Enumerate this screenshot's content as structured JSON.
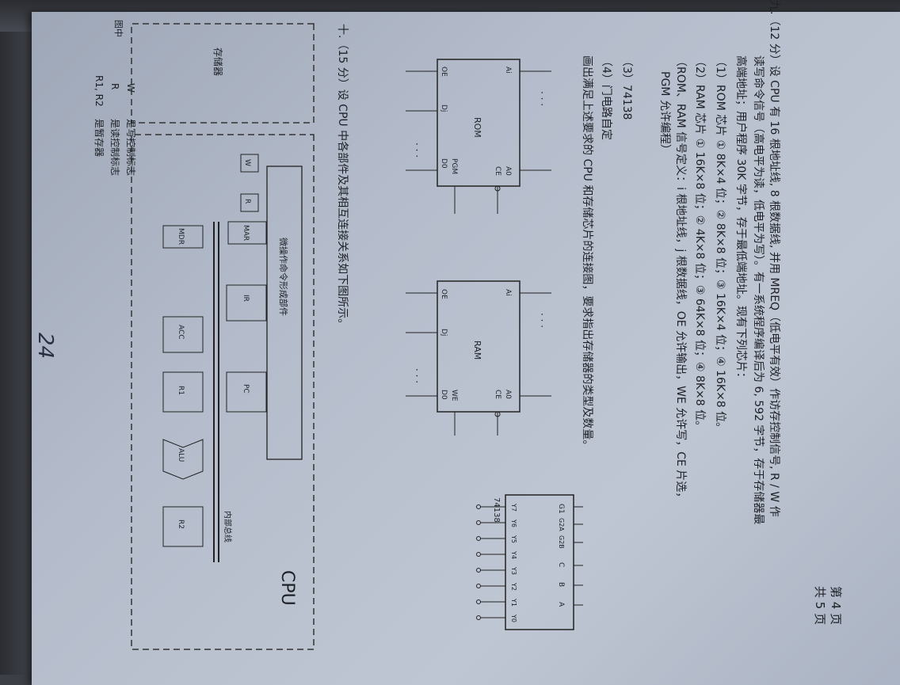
{
  "page": {
    "current_label": "第 4 页",
    "total_label": "共 5 页"
  },
  "q9": {
    "l1": "九.（12 分）设 CPU 有 16 根地址线, 8 根数据线, 并用 MREQ（低电平有效）作访存控制信号, R / W 作",
    "l2": "读写命令信号（高电平为读，低电平为写）。有一系统程序编译后为 6, 592 字节，存于存储器最",
    "l3": "高端地址；用户程序 30K 字节，存于最低端地址。现有下列芯片：",
    "rom": "（1）ROM 芯片 ① 8K×4 位；② 8K×8 位；③ 16K×4 位；④ 16K×8 位。",
    "ram": "（2）RAM 芯片 ① 16K×8 位；② 4K×8 位；③ 64K×8 位；④ 8K×8 位。",
    "sig1": "（ROM、RAM 信号定义：i 根地址线，j 根数据线，OE 允许输出，WE 允许写，CE 片选，",
    "sig2": "PGM 允许编程）",
    "i3": "（3）74138",
    "i4": "（4）门电路自定",
    "task": "画出满足上述要求的 CPU 和存储芯片的连接图，要求指出存储器的类型及数量。"
  },
  "rom_chip": {
    "name": "ROM",
    "ai": "Ai",
    "a0": "A0",
    "ce": "CE",
    "oe": "OE",
    "pgm": "PGM",
    "dj": "Dj",
    "d0": "D0",
    "dots": "· · ·"
  },
  "ram_chip": {
    "name": "RAM",
    "ai": "Ai",
    "a0": "A0",
    "ce": "CE",
    "oe": "OE",
    "we": "WE",
    "dj": "Dj",
    "d0": "D0",
    "dots": "· · ·"
  },
  "decoder": {
    "name": "74138",
    "g1": "G1",
    "g2a": "G2A",
    "g2b": "G2B",
    "c": "C",
    "b": "B",
    "a": "A",
    "outs": [
      "Y7",
      "Y6",
      "Y5",
      "Y4",
      "Y3",
      "Y2",
      "Y1",
      "Y0"
    ]
  },
  "q10": {
    "title": "十.（15 分）设 CPU 中各部件及其相互连接关系如下图所示。",
    "cpu": "CPU",
    "memory": "存储器",
    "bus": "内部总线",
    "micro": "微操作命令形成部件",
    "W": "W",
    "R": "R",
    "MAR": "MAR",
    "MDR": "MDR",
    "IR": "IR",
    "ACC": "ACC",
    "PC": "PC",
    "R1": "R1",
    "ALU": "ALU",
    "R2": "R2",
    "legend_head": "图中",
    "legend": [
      {
        "k": "W",
        "v": "是写控制标志"
      },
      {
        "k": "R",
        "v": "是读控制标志"
      },
      {
        "k": "R1, R2",
        "v": "是暂存器"
      }
    ]
  },
  "handwriting": "24"
}
